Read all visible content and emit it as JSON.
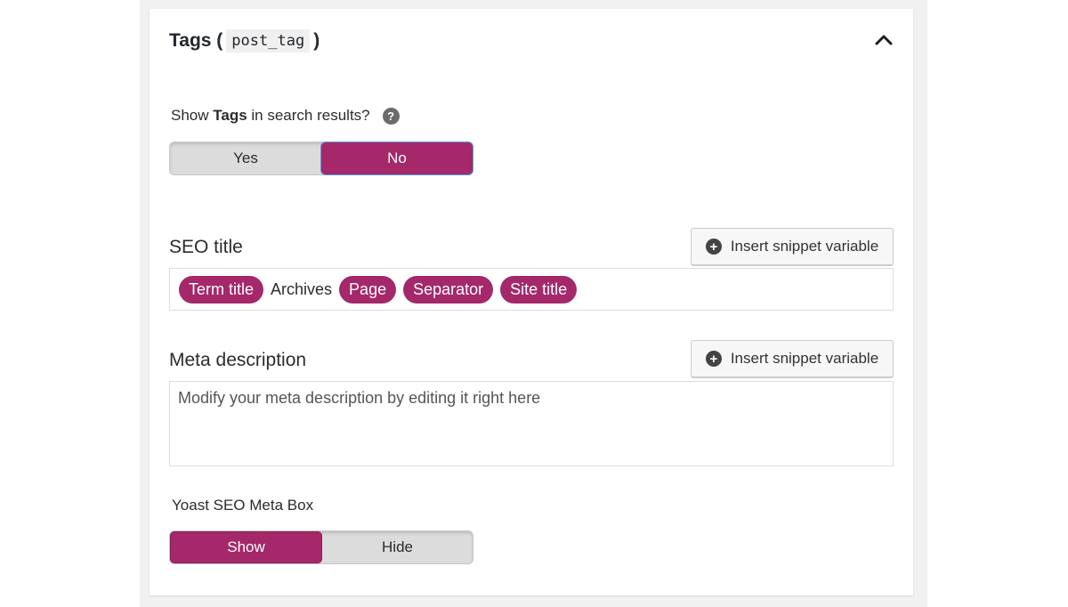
{
  "header": {
    "title_prefix": "Tags (",
    "taxonomy": "post_tag",
    "title_suffix": ")",
    "collapse_icon": "chevron-up-icon"
  },
  "search_results": {
    "label_prefix": "Show ",
    "label_bold": "Tags",
    "label_suffix": " in search results?",
    "help_icon_text": "?",
    "options": [
      "Yes",
      "No"
    ],
    "selected": "No"
  },
  "seo_title": {
    "label": "SEO title",
    "insert_button": "Insert snippet variable",
    "tokens": [
      {
        "type": "pill",
        "text": "Term title"
      },
      {
        "type": "text",
        "text": "Archives"
      },
      {
        "type": "pill",
        "text": "Page"
      },
      {
        "type": "pill",
        "text": "Separator"
      },
      {
        "type": "pill",
        "text": "Site title"
      }
    ]
  },
  "meta_description": {
    "label": "Meta description",
    "insert_button": "Insert snippet variable",
    "placeholder": "Modify your meta description by editing it right here"
  },
  "meta_box": {
    "label": "Yoast SEO Meta Box",
    "options": [
      "Show",
      "Hide"
    ],
    "selected": "Show"
  },
  "colors": {
    "accent": "#a4286a",
    "focus": "#5b9dd9"
  }
}
